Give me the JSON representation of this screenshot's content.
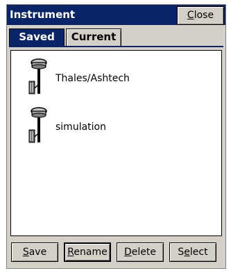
{
  "window": {
    "title": "Instrument",
    "close_label": "Close",
    "close_mnemonic": "C",
    "close_rest": "lose"
  },
  "tabs": [
    {
      "label": "Saved",
      "active": true
    },
    {
      "label": "Current",
      "active": false
    }
  ],
  "instruments": [
    {
      "name": "Thales/Ashtech",
      "icon": "gps-receiver-icon"
    },
    {
      "name": "simulation",
      "icon": "gps-receiver-icon"
    }
  ],
  "buttons": {
    "save": {
      "mnemonic": "S",
      "rest": "ave"
    },
    "rename": {
      "mnemonic": "R",
      "rest": "ename"
    },
    "delete": {
      "mnemonic": "D",
      "rest": "elete"
    },
    "select": {
      "first": "S",
      "mnemonic": "e",
      "rest": "lect"
    }
  },
  "colors": {
    "titlebar": "#0a246a",
    "face": "#d4d0c8",
    "list_bg": "#ffffff"
  }
}
